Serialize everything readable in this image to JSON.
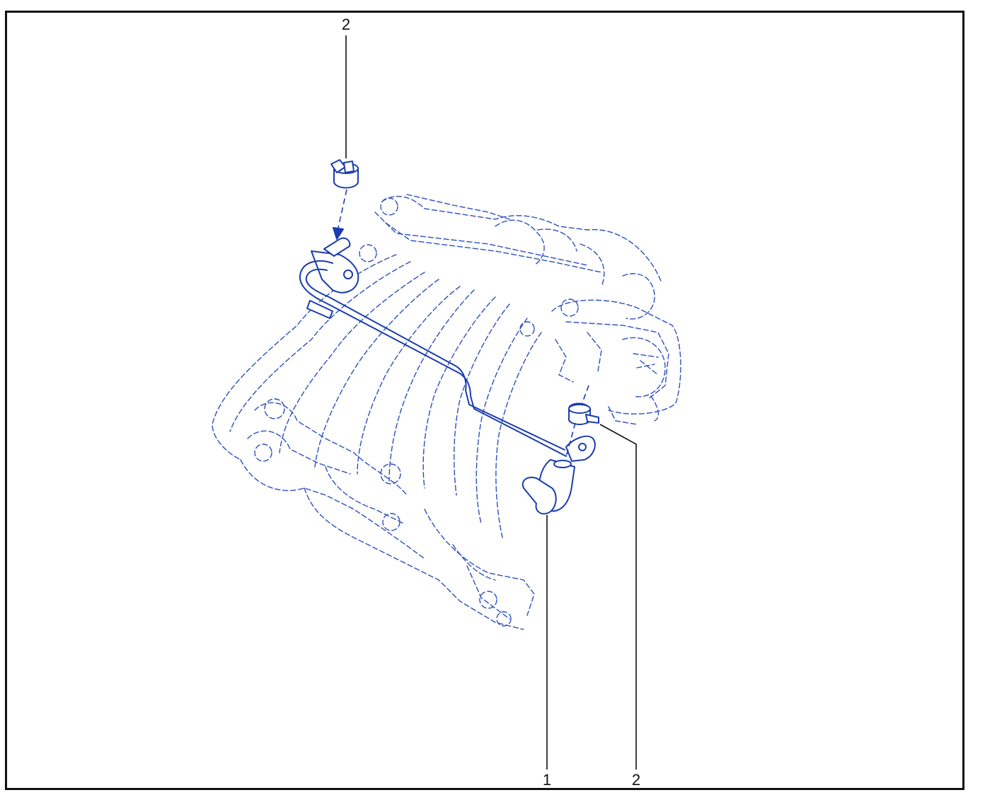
{
  "diagram": {
    "callouts": [
      {
        "label": "2"
      },
      {
        "label": "1"
      },
      {
        "label": "2"
      }
    ],
    "colors": {
      "line_art": "#1a3cb0",
      "phantom": "#2d4fbf",
      "frame": "#111111"
    }
  }
}
